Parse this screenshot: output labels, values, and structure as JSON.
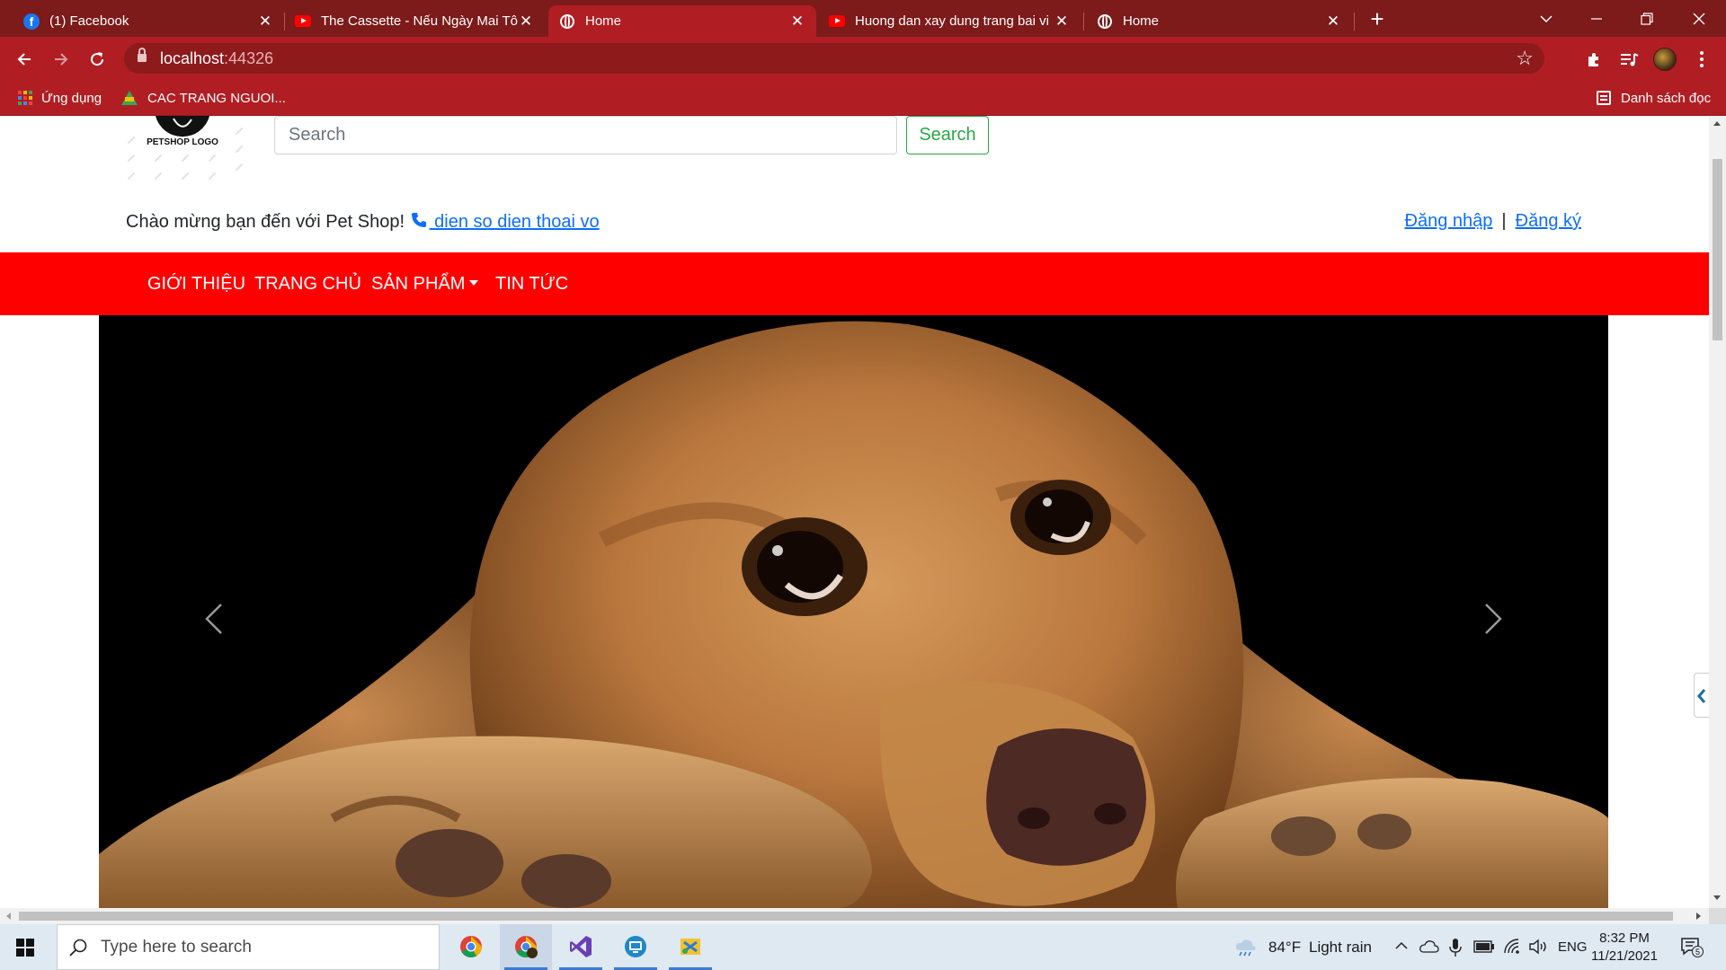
{
  "browser": {
    "tabs": [
      {
        "title": "(1) Facebook",
        "icon": "facebook-icon"
      },
      {
        "title": "The Cassette - Nếu Ngày Mai Tôi",
        "icon": "youtube-icon"
      },
      {
        "title": "Home",
        "icon": "globe-icon",
        "active": true
      },
      {
        "title": "Huong dan xay dung trang bai vi",
        "icon": "youtube-icon"
      },
      {
        "title": "Home",
        "icon": "globe-icon"
      }
    ],
    "url_host": "localhost",
    "url_port": ":44326",
    "bookmarks": [
      {
        "label": "Ứng dụng",
        "icon": "apps-grid-icon"
      },
      {
        "label": "CAC TRANG NGUOI...",
        "icon": "google-drive-icon"
      }
    ],
    "reading_list": "Danh sách đọc",
    "theme_color": "#b01e23",
    "tabstrip_color": "#7d1a1a"
  },
  "page": {
    "logo_text": "PETSHOP LOGO",
    "search": {
      "placeholder": "Search",
      "button": "Search"
    },
    "welcome_text": "Chào mừng bạn đến với Pet Shop!",
    "phone_link": " dien so dien thoai vo",
    "auth": {
      "login": "Đăng nhập",
      "separator": "|",
      "register": "Đăng ký"
    },
    "nav": {
      "items": [
        "GIỚI THIỆU",
        "TRANG CHỦ",
        "SẢN PHẨM",
        "TIN TỨC"
      ],
      "background": "#ff0000"
    },
    "carousel": {
      "image": "golden-retriever-photo"
    }
  },
  "taskbar": {
    "search_placeholder": "Type here to search",
    "apps": [
      "chrome-icon",
      "chrome-profile-icon",
      "visual-studio-icon",
      "remote-desktop-icon",
      "app-icon"
    ],
    "weather_temp": "84°F",
    "weather_text": "Light rain",
    "language": "ENG",
    "time": "8:32 PM",
    "date": "11/21/2021",
    "notification_count": "5"
  }
}
